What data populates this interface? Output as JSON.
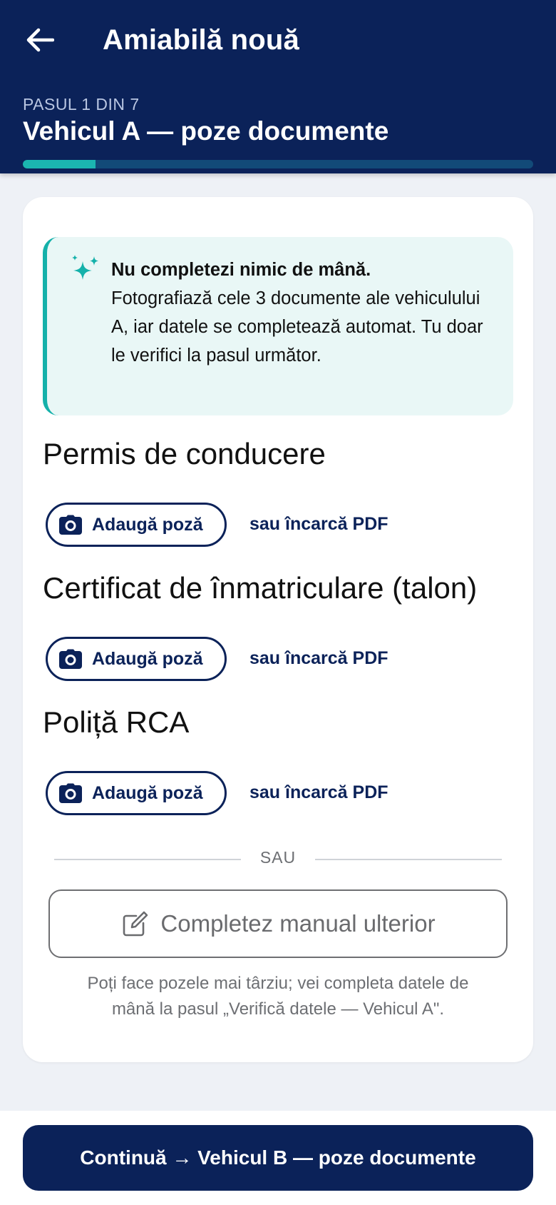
{
  "header": {
    "title": "Amiabilă nouă",
    "back_icon": "arrow-left-icon",
    "step_label": "PASUL 1 DIN 7",
    "step_title": "Vehicul A — poze documente",
    "progress_fraction": 0.143
  },
  "info": {
    "icon": "sparkles-icon",
    "bold": "Nu completezi nimic de mână.",
    "text": "Fotografiază cele 3 documente ale vehiculului A, iar datele se completează automat. Tu doar le verifici la pasul următor."
  },
  "documents": [
    {
      "title": "Permis de conducere",
      "add_label": "Adaugă poză",
      "pdf_label": "sau încarcă PDF"
    },
    {
      "title": "Certificat de înmatriculare (talon)",
      "add_label": "Adaugă poză",
      "pdf_label": "sau încarcă PDF"
    },
    {
      "title": "Poliță RCA",
      "add_label": "Adaugă poză",
      "pdf_label": "sau încarcă PDF"
    }
  ],
  "divider": {
    "label": "SAU"
  },
  "manual": {
    "label": "Completez manual ulterior",
    "icon": "edit-icon",
    "hint": "Poți face pozele mai târziu; vei completa datele de mână la pasul „Verifică datele — Vehicul A\"."
  },
  "footer": {
    "continue_label": "Continuă → Vehicul B — poze documente"
  },
  "colors": {
    "primary": "#0b2259",
    "accent": "#1bb5b0",
    "info_bg": "#e9f7f6"
  }
}
